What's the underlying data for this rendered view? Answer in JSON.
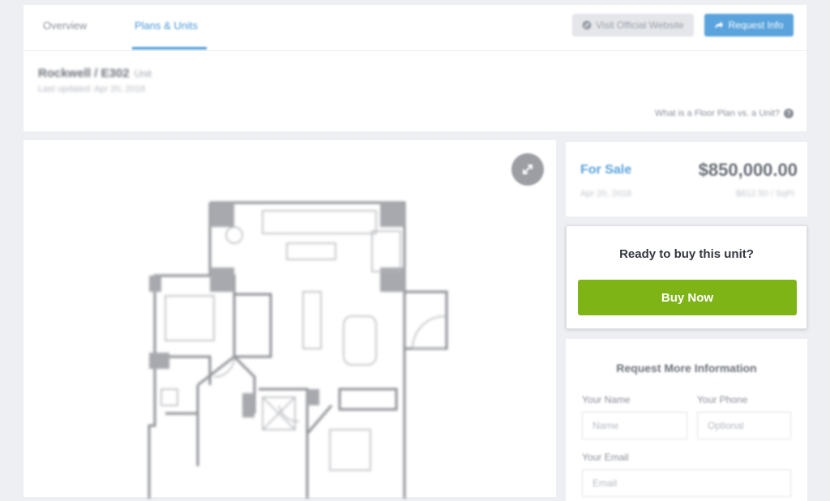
{
  "tabs": [
    {
      "label": "Overview"
    },
    {
      "label": "Plans & Units"
    }
  ],
  "buttons": {
    "visit_website": "Visit Official Website",
    "request_info": "Request Info"
  },
  "unit": {
    "title": "Rockwell / E302",
    "title_suffix": "Unit",
    "last_updated": "Last updated: Apr 20, 2018",
    "floor_plan_question": "What is a Floor Plan vs. a Unit?"
  },
  "pricing": {
    "status": "For Sale",
    "price": "$850,000.00",
    "date": "Apr 20, 2018",
    "per_sqft": "$812.50 / SqFt"
  },
  "buy": {
    "question": "Ready to buy this unit?",
    "button": "Buy Now"
  },
  "request_form": {
    "title": "Request More Information",
    "name_label": "Your Name",
    "name_placeholder": "Name",
    "phone_label": "Your Phone",
    "phone_placeholder": "Optional",
    "email_label": "Your Email",
    "email_placeholder": "Email"
  },
  "colors": {
    "accent_blue": "#5aa3dc",
    "buy_green": "#7eb416",
    "background": "#eeeff3"
  }
}
